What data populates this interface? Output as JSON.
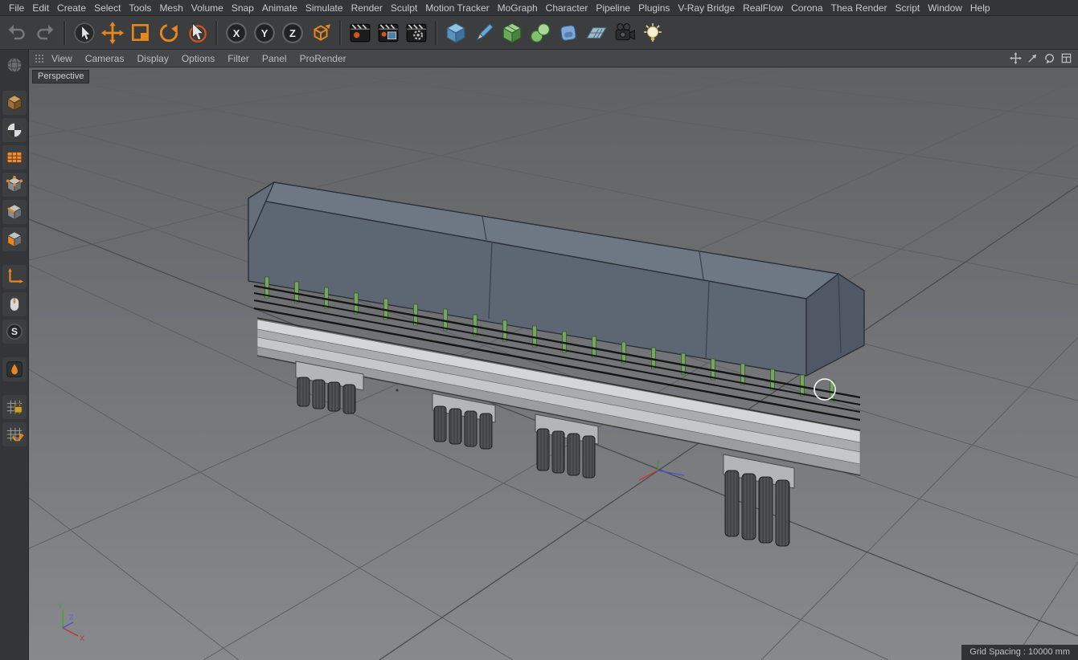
{
  "menubar": {
    "items": [
      "File",
      "Edit",
      "Create",
      "Select",
      "Tools",
      "Mesh",
      "Volume",
      "Snap",
      "Animate",
      "Simulate",
      "Render",
      "Sculpt",
      "Motion Tracker",
      "MoGraph",
      "Character",
      "Pipeline",
      "Plugins",
      "V-Ray Bridge",
      "RealFlow",
      "Corona",
      "Thea Render",
      "Script",
      "Window",
      "Help"
    ]
  },
  "toolbar": {
    "axis_labels": {
      "x": "X",
      "y": "Y",
      "z": "Z"
    },
    "tools": [
      "undo",
      "redo",
      "live-selection",
      "move",
      "scale",
      "rotate",
      "last-used-tool",
      "lock-x-axis",
      "lock-y-axis",
      "lock-z-axis",
      "coordinate-system",
      "render-view",
      "render-to-picture-viewer",
      "edit-render-settings",
      "add-cube-primitive",
      "pen-spline",
      "subdivision-surface",
      "cloner",
      "deformer",
      "floor",
      "camera",
      "light"
    ]
  },
  "sidebar": {
    "snap_label": "S",
    "tools": [
      "world-coordinates",
      "make-editable",
      "texture-mode",
      "workplane-mode",
      "point-mode",
      "edge-mode",
      "polygon-mode",
      "enable-axis",
      "tweak-mode",
      "snap",
      "viewport-solo",
      "lock-workplane",
      "planar-workplane"
    ]
  },
  "viewport_menu": {
    "items": [
      "View",
      "Cameras",
      "Display",
      "Options",
      "Filter",
      "Panel",
      "ProRender"
    ],
    "nav_icons": [
      "pan-view-icon",
      "dolly-view-icon",
      "rotate-view-icon",
      "toggle-panel-icon"
    ]
  },
  "viewport": {
    "camera_label": "Perspective",
    "status": {
      "grid_spacing": "Grid Spacing : 10000 mm"
    },
    "axis_gizmo": {
      "x": "X",
      "y": "Y",
      "z": "Z"
    }
  },
  "colors": {
    "accent_orange": "#e8871d",
    "menubar_bg": "#333538",
    "toolbar_bg": "#3b3d3f",
    "viewport_top": "#5e6062",
    "viewport_bottom": "#87898c",
    "grid_line": "#5d5f62",
    "cover_side": "#5d6773",
    "cover_top": "#6e7884",
    "deck_light": "#d4d5d7",
    "post_green": "#76a55f",
    "railing_black": "#151515"
  }
}
